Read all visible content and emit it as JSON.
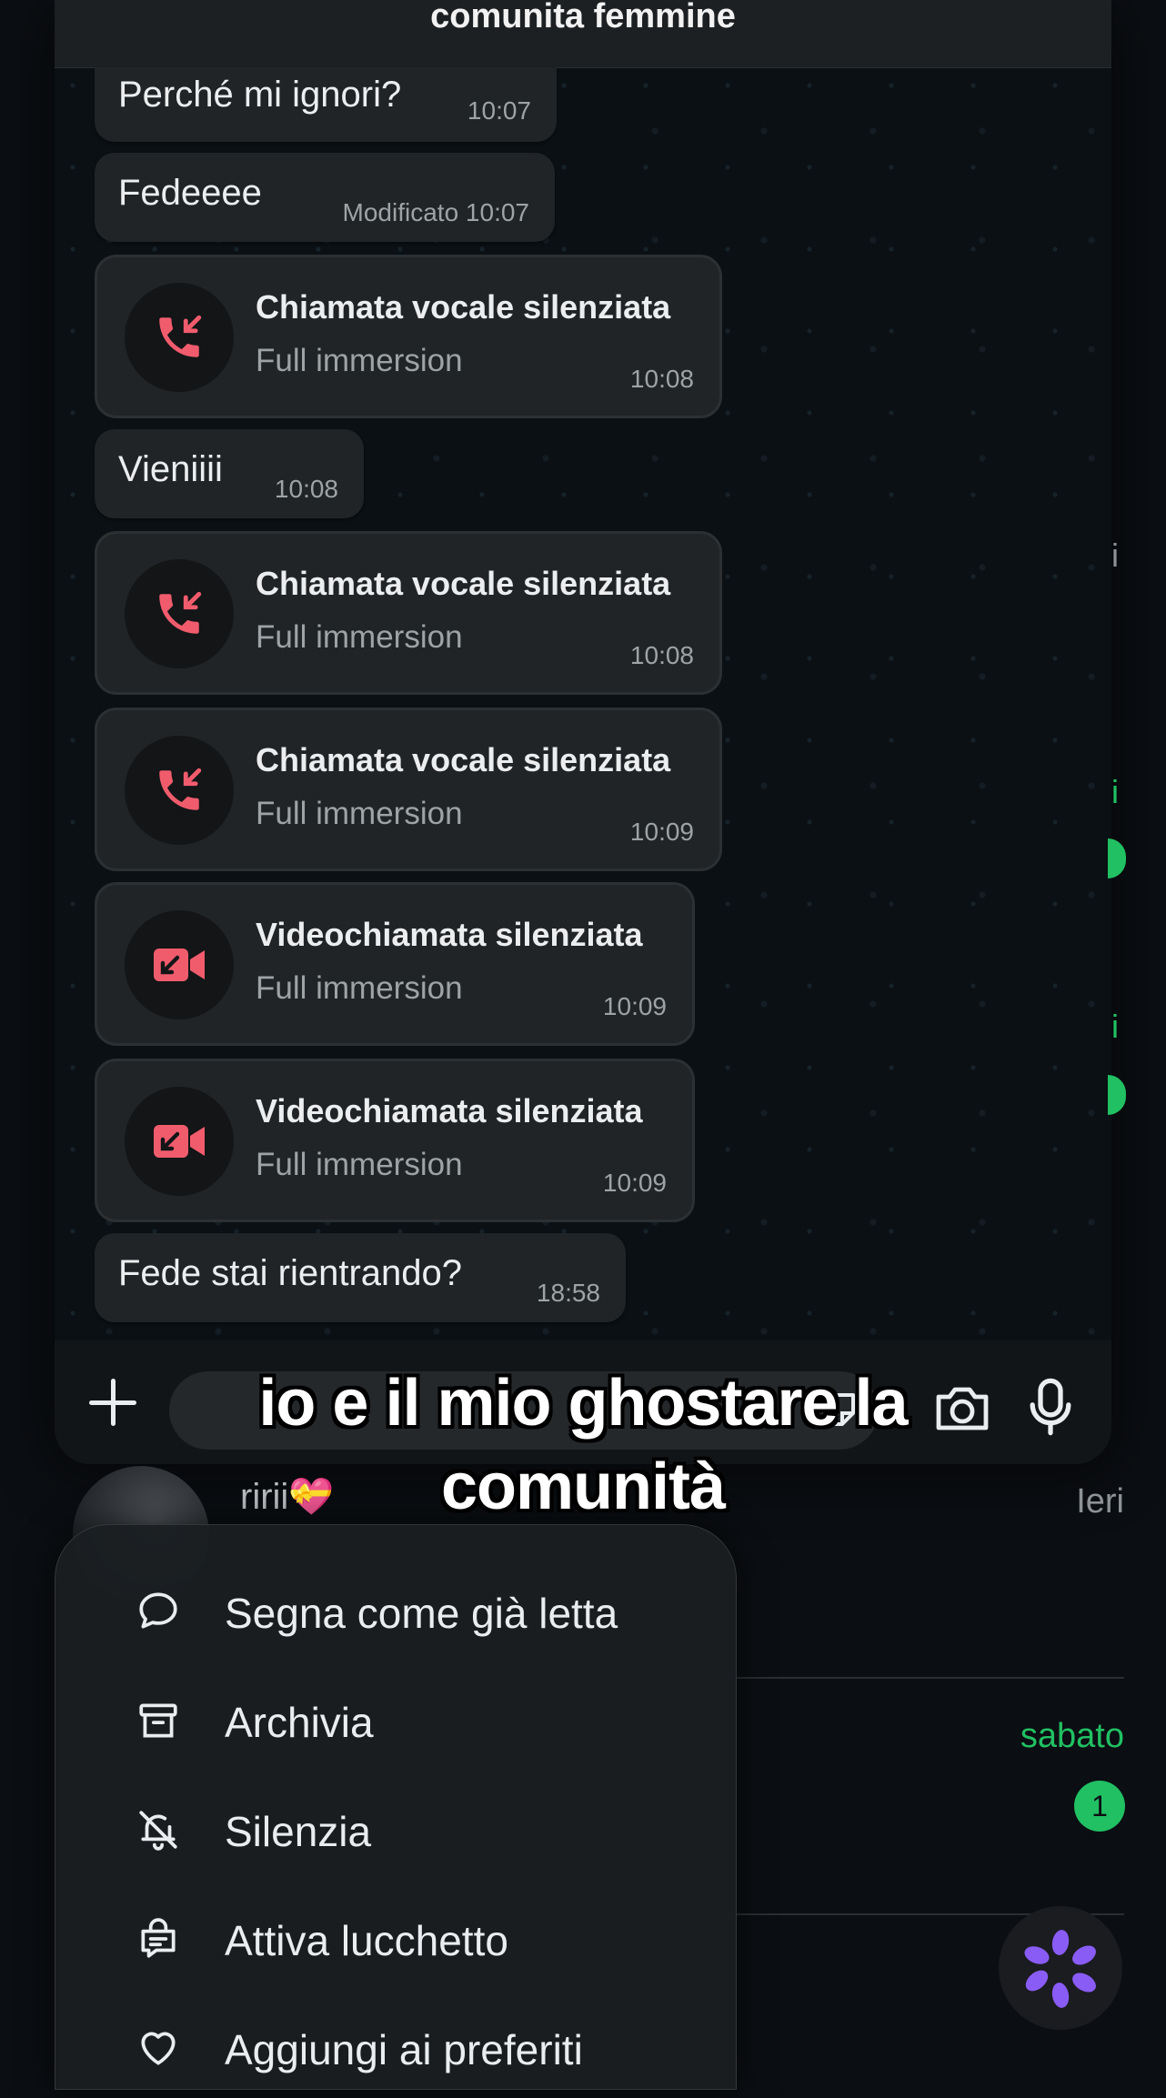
{
  "header": {
    "title": "comunita femmine"
  },
  "messages": [
    {
      "type": "text",
      "text": "Perché mi ignori?",
      "time": "10:07"
    },
    {
      "type": "text",
      "text": "Fedeeee",
      "time": "Modificato 10:07"
    },
    {
      "type": "call",
      "icon": "missed-voice-call-icon",
      "title": "Chiamata vocale silenziata",
      "subtitle": "Full immersion",
      "time": "10:08"
    },
    {
      "type": "text",
      "text": "Vieniiii",
      "time": "10:08"
    },
    {
      "type": "call",
      "icon": "missed-voice-call-icon",
      "title": "Chiamata vocale silenziata",
      "subtitle": "Full immersion",
      "time": "10:08"
    },
    {
      "type": "call",
      "icon": "missed-voice-call-icon",
      "title": "Chiamata vocale silenziata",
      "subtitle": "Full immersion",
      "time": "10:09"
    },
    {
      "type": "call",
      "icon": "missed-video-call-icon",
      "title": "Videochiamata silenziata",
      "subtitle": "Full immersion",
      "time": "10:09"
    },
    {
      "type": "call",
      "icon": "missed-video-call-icon",
      "title": "Videochiamata silenziata",
      "subtitle": "Full immersion",
      "time": "10:09"
    },
    {
      "type": "text",
      "text": "Fede stai rientrando?",
      "time": "18:58"
    }
  ],
  "composer": {
    "icons": [
      "plus-icon",
      "sticker-icon",
      "camera-icon",
      "microphone-icon"
    ]
  },
  "caption": {
    "line1": "io e il mio ghostare la",
    "line2": "comunità"
  },
  "chat_list": {
    "row1": {
      "name": "ririi💝",
      "time": "Ieri"
    },
    "row2": {
      "time": "sabato",
      "unread": "1"
    },
    "edge_fragments": [
      "i",
      "i",
      "i"
    ]
  },
  "context_menu": {
    "items": [
      {
        "label": "Segna come già letta",
        "icon": "chat-bubble-icon"
      },
      {
        "label": "Archivia",
        "icon": "archive-box-icon"
      },
      {
        "label": "Silenzia",
        "icon": "bell-off-icon"
      },
      {
        "label": "Attiva lucchetto",
        "icon": "chat-lock-icon"
      },
      {
        "label": "Aggiungi ai preferiti",
        "icon": "heart-icon"
      }
    ]
  },
  "colors": {
    "accent_green": "#21c063",
    "missed_call_red": "#f15c6d",
    "bubble_bg": "#202427",
    "meta_ai_purple": "#8a5cf6"
  }
}
